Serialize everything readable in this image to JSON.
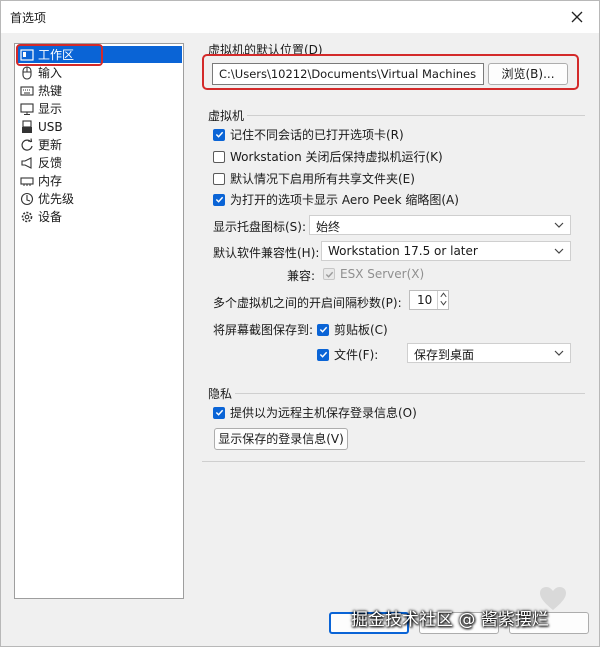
{
  "window": {
    "title": "首选项"
  },
  "nav": {
    "items": [
      {
        "label": "工作区",
        "icon": "workspace-icon",
        "selected": true
      },
      {
        "label": "输入",
        "icon": "mouse-icon"
      },
      {
        "label": "热键",
        "icon": "keyboard-icon"
      },
      {
        "label": "显示",
        "icon": "monitor-icon"
      },
      {
        "label": "USB",
        "icon": "usb-icon"
      },
      {
        "label": "更新",
        "icon": "refresh-icon"
      },
      {
        "label": "反馈",
        "icon": "megaphone-icon"
      },
      {
        "label": "内存",
        "icon": "memory-icon"
      },
      {
        "label": "优先级",
        "icon": "priority-icon"
      },
      {
        "label": "设备",
        "icon": "gear-icon"
      }
    ]
  },
  "default_location": {
    "label": "虚拟机的默认位置(D)",
    "path": "C:\\Users\\10212\\Documents\\Virtual Machines",
    "browse_label": "浏览(B)..."
  },
  "vm_section": {
    "label": "虚拟机",
    "options": [
      {
        "label": "记住不同会话的已打开选项卡(R)",
        "checked": true
      },
      {
        "label": "Workstation 关闭后保持虚拟机运行(K)",
        "checked": false
      },
      {
        "label": "默认情况下启用所有共享文件夹(E)",
        "checked": false
      },
      {
        "label": "为打开的选项卡显示 Aero Peek 缩略图(A)",
        "checked": true
      }
    ],
    "tray_icon": {
      "label": "显示托盘图标(S):",
      "value": "始终"
    },
    "compat": {
      "label": "默认软件兼容性(H):",
      "value": "Workstation 17.5 or later"
    },
    "compat_sub": {
      "label": "兼容:",
      "option": "ESX Server(X)"
    },
    "interval": {
      "label": "多个虚拟机之间的开启间隔秒数(P):",
      "value": "10"
    },
    "screenshot": {
      "label": "将屏幕截图保存到:",
      "clipboard": "剪贴板(C)",
      "file": "文件(F):",
      "file_target": "保存到桌面"
    }
  },
  "privacy": {
    "label": "隐私",
    "option": "提供以为远程主机保存登录信息(O)",
    "button": "显示保存的登录信息(V)"
  },
  "watermark": "掘金技术社区 @ 酱紫摆烂",
  "colors": {
    "accent": "#0a64d6",
    "annotation": "#d32a2a"
  }
}
